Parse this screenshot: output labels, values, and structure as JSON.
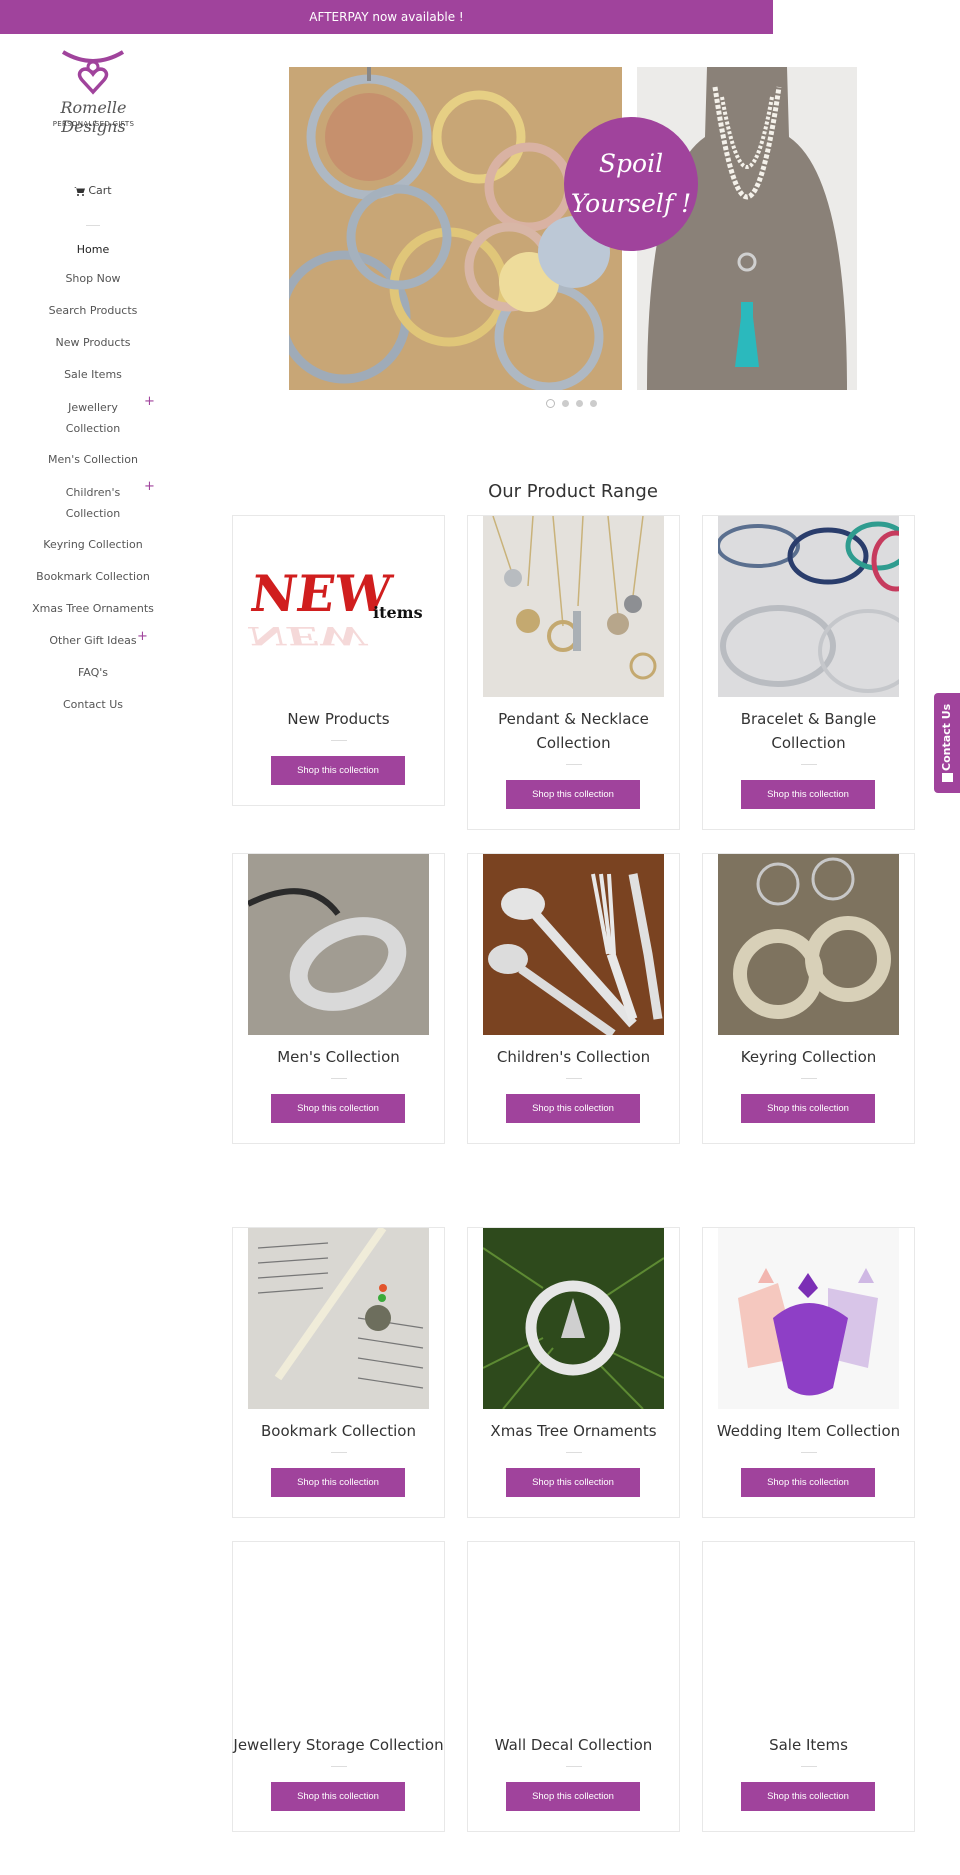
{
  "topbar": {
    "text": "AFTERPAY now available !"
  },
  "logo": {
    "name": "Romelle Designs",
    "tagline": "PERSONALISED GIFTS"
  },
  "sidebar": {
    "cart_label": "Cart",
    "nav": [
      {
        "label": "Home"
      },
      {
        "label": "Shop Now"
      },
      {
        "label": "Search Products"
      },
      {
        "label": "New Products"
      },
      {
        "label": "Sale Items"
      },
      {
        "label": "Jewellery",
        "label2": "Collection",
        "expandable": true
      },
      {
        "label": "Men's Collection"
      },
      {
        "label": "Children's",
        "label2": "Collection",
        "expandable": true
      },
      {
        "label": "Keyring Collection"
      },
      {
        "label": "Bookmark Collection"
      },
      {
        "label": "Xmas Tree Ornaments"
      },
      {
        "label": "Other Gift Ideas",
        "expandable": true
      },
      {
        "label": "FAQ's"
      },
      {
        "label": "Contact Us"
      }
    ],
    "plus_symbol": "+"
  },
  "hero": {
    "badge_line1": "Spoil",
    "badge_line2": "Yourself !",
    "slide_count": 4,
    "active_slide": 1
  },
  "section_title": "Our Product Range",
  "products": [
    {
      "name": "New Products",
      "button": "Shop this collection"
    },
    {
      "name": "Pendant & Necklace",
      "name2": "Collection",
      "button": "Shop this collection"
    },
    {
      "name": "Bracelet & Bangle",
      "name2": "Collection",
      "button": "Shop this collection"
    },
    {
      "name": "Men's Collection",
      "button": "Shop this collection"
    },
    {
      "name": "Children's Collection",
      "button": "Shop this collection"
    },
    {
      "name": "Keyring Collection",
      "button": "Shop this collection"
    },
    {
      "name": "Bookmark Collection",
      "button": "Shop this collection"
    },
    {
      "name": "Xmas Tree Ornaments",
      "button": "Shop this collection"
    },
    {
      "name": "Wedding Item Collection",
      "button": "Shop this collection"
    },
    {
      "name": "Jewellery Storage Collection",
      "button": "Shop this collection"
    },
    {
      "name": "Wall Decal Collection",
      "button": "Shop this collection"
    },
    {
      "name": "Sale Items",
      "button": "Shop this collection"
    }
  ],
  "product_images": {
    "new_badge_big": "NEW",
    "new_badge_small": "items"
  },
  "contact_tab": {
    "label": "Contact Us"
  },
  "colors": {
    "accent": "#a0439c",
    "border": "#e8e8e8",
    "text": "#333333"
  }
}
